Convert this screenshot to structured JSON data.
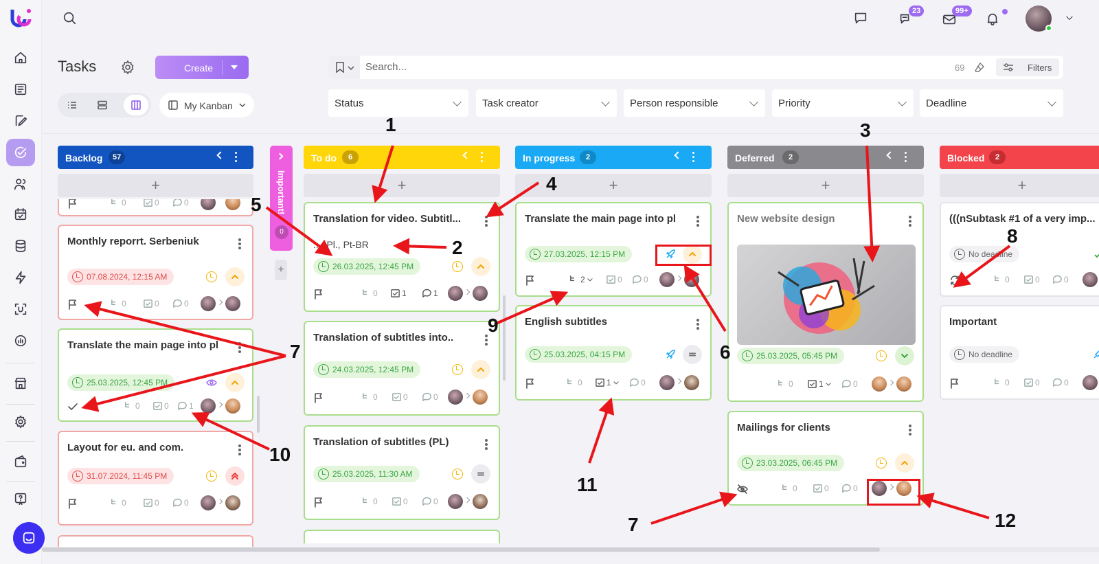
{
  "header": {
    "title": "Tasks",
    "create_label": "Create",
    "kanban_label": "My Kanban",
    "search_placeholder": "Search...",
    "search_count": "69",
    "filters_label": "Filters",
    "chat_badge": "23",
    "mail_badge": "99+"
  },
  "filters": [
    "Status",
    "Task creator",
    "Person responsible",
    "Priority",
    "Deadline"
  ],
  "columns": {
    "backlog": {
      "name": "Backlog",
      "count": "57",
      "color": "#1255c1"
    },
    "important": {
      "name": "Important!",
      "count": "0",
      "color": "#ee5fe0"
    },
    "todo": {
      "name": "To do",
      "count": "6",
      "color": "#ffd60a"
    },
    "inprogress": {
      "name": "In progress",
      "count": "2",
      "color": "#1aa9f5"
    },
    "deferred": {
      "name": "Deferred",
      "count": "2",
      "color": "#8a8a8e"
    },
    "blocked": {
      "name": "Blocked",
      "count": "2",
      "color": "#f2444a"
    }
  },
  "cards": {
    "b0": {
      "s1": "0",
      "s2": "0",
      "s3": "0"
    },
    "b1": {
      "title": "Monthly reporrt. Serbeniuk",
      "deadline": "07.08.2024, 12:15 AM",
      "s1": "0",
      "s2": "0",
      "s3": "0"
    },
    "b2": {
      "title": "Translate the main page into pl",
      "deadline": "25.03.2025, 12:45 PM",
      "s1": "0",
      "s2": "0",
      "s3": "1"
    },
    "b3": {
      "title": "Layout for eu. and com.",
      "deadline": "31.07.2024, 11:45 PM",
      "s1": "0",
      "s2": "0",
      "s3": "0"
    },
    "t1": {
      "title": "Translation for video. Subtitl...",
      "sub": "..., Pl., Pt-BR",
      "deadline": "26.03.2025, 12:45 PM",
      "s1": "0",
      "s2": "1",
      "s3": "1"
    },
    "t2": {
      "title": "Translation of subtitles into..",
      "deadline": "24.03.2025, 12:45 PM",
      "s1": "0",
      "s2": "0",
      "s3": "0"
    },
    "t3": {
      "title": "Translation of subtitles (PL)",
      "deadline": "25.03.2025, 11:30 AM",
      "s1": "0",
      "s2": "0",
      "s3": "0"
    },
    "p1": {
      "title": "Translate the main page into pl",
      "deadline": "27.03.2025, 12:15 PM",
      "s1": "2",
      "s2": "0",
      "s3": "0"
    },
    "p2": {
      "title": "English subtitles",
      "deadline": "25.03.2025, 04:15 PM",
      "s1": "0",
      "s2": "1",
      "s3": "0"
    },
    "d1": {
      "title": "New website design",
      "deadline": "25.03.2025, 05:45 PM",
      "s1": "0",
      "s2": "1",
      "s3": "0"
    },
    "d2": {
      "title": "Mailings for clients",
      "deadline": "23.03.2025, 06:45 PM",
      "s1": "0",
      "s2": "0",
      "s3": "0"
    },
    "k1": {
      "title": "(((nSubtask #1 of a very imp...",
      "deadline": "No deadline",
      "s1": "0",
      "s2": "0",
      "s3": "0"
    },
    "k2": {
      "title": "Important",
      "deadline": "No deadline",
      "s1": "0",
      "s2": "0",
      "s3": "0"
    }
  },
  "annotations": [
    "1",
    "2",
    "3",
    "4",
    "5",
    "6",
    "7",
    "7",
    "8",
    "9",
    "10",
    "11",
    "7",
    "12"
  ]
}
